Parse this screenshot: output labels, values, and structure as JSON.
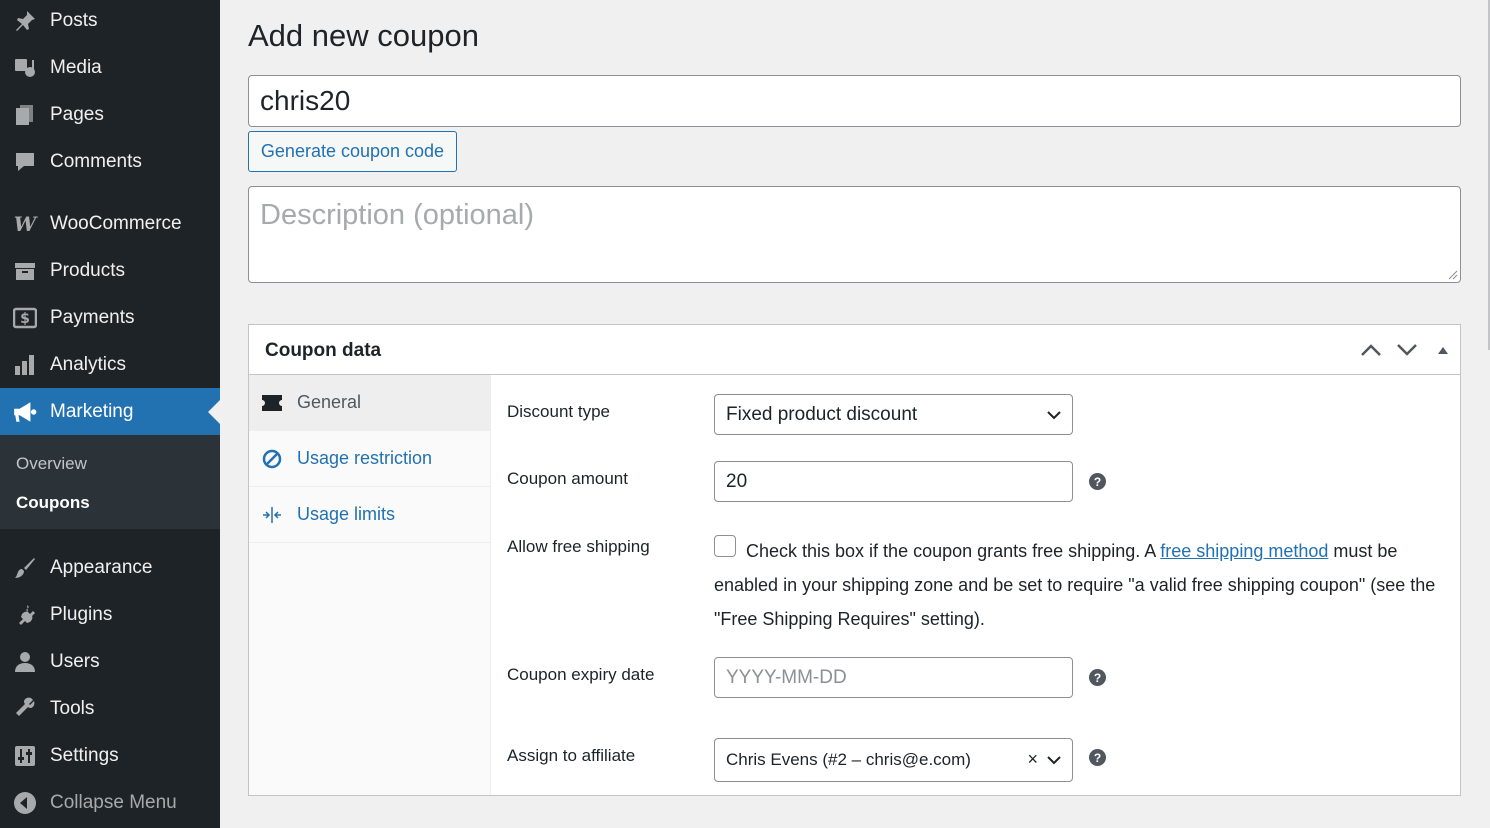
{
  "sidebar": {
    "items": [
      {
        "label": "Posts",
        "icon": "pushpin-icon"
      },
      {
        "label": "Media",
        "icon": "media-icon"
      },
      {
        "label": "Pages",
        "icon": "pages-icon"
      },
      {
        "label": "Comments",
        "icon": "comments-icon"
      },
      {
        "label": "WooCommerce",
        "icon": "woocommerce-icon"
      },
      {
        "label": "Products",
        "icon": "archive-icon"
      },
      {
        "label": "Payments",
        "icon": "dollar-icon"
      },
      {
        "label": "Analytics",
        "icon": "bar-chart-icon"
      },
      {
        "label": "Marketing",
        "icon": "megaphone-icon"
      },
      {
        "label": "Appearance",
        "icon": "paintbrush-icon"
      },
      {
        "label": "Plugins",
        "icon": "plugin-icon"
      },
      {
        "label": "Users",
        "icon": "user-icon"
      },
      {
        "label": "Tools",
        "icon": "wrench-icon"
      },
      {
        "label": "Settings",
        "icon": "settings-sliders-icon"
      }
    ],
    "submenu": {
      "overview": "Overview",
      "coupons": "Coupons"
    },
    "collapse": "Collapse Menu",
    "active_color": "#2271b1"
  },
  "page": {
    "title": "Add new coupon",
    "coupon_code_value": "chris20",
    "generate_button": "Generate coupon code",
    "description_placeholder": "Description (optional)"
  },
  "coupon_box": {
    "title": "Coupon data",
    "tabs": [
      {
        "label": "General",
        "icon": "ticket-icon"
      },
      {
        "label": "Usage restriction",
        "icon": "no-entry-icon"
      },
      {
        "label": "Usage limits",
        "icon": "arrows-in-icon"
      }
    ],
    "fields": {
      "discount_type": {
        "label": "Discount type",
        "value": "Fixed product discount"
      },
      "coupon_amount": {
        "label": "Coupon amount",
        "value": "20"
      },
      "free_shipping": {
        "label": "Allow free shipping",
        "text_before": "Check this box if the coupon grants free shipping. A ",
        "link": "free shipping method",
        "text_after": " must be enabled in your shipping zone and be set to require \"a valid free shipping coupon\" (see the \"Free Shipping Requires\" setting).",
        "checked": false
      },
      "expiry_date": {
        "label": "Coupon expiry date",
        "placeholder": "YYYY-MM-DD"
      },
      "affiliate": {
        "label": "Assign to affiliate",
        "value": "Chris Evens (#2 – chris@e.com)",
        "clear": "×"
      }
    },
    "help_glyph": "?"
  }
}
